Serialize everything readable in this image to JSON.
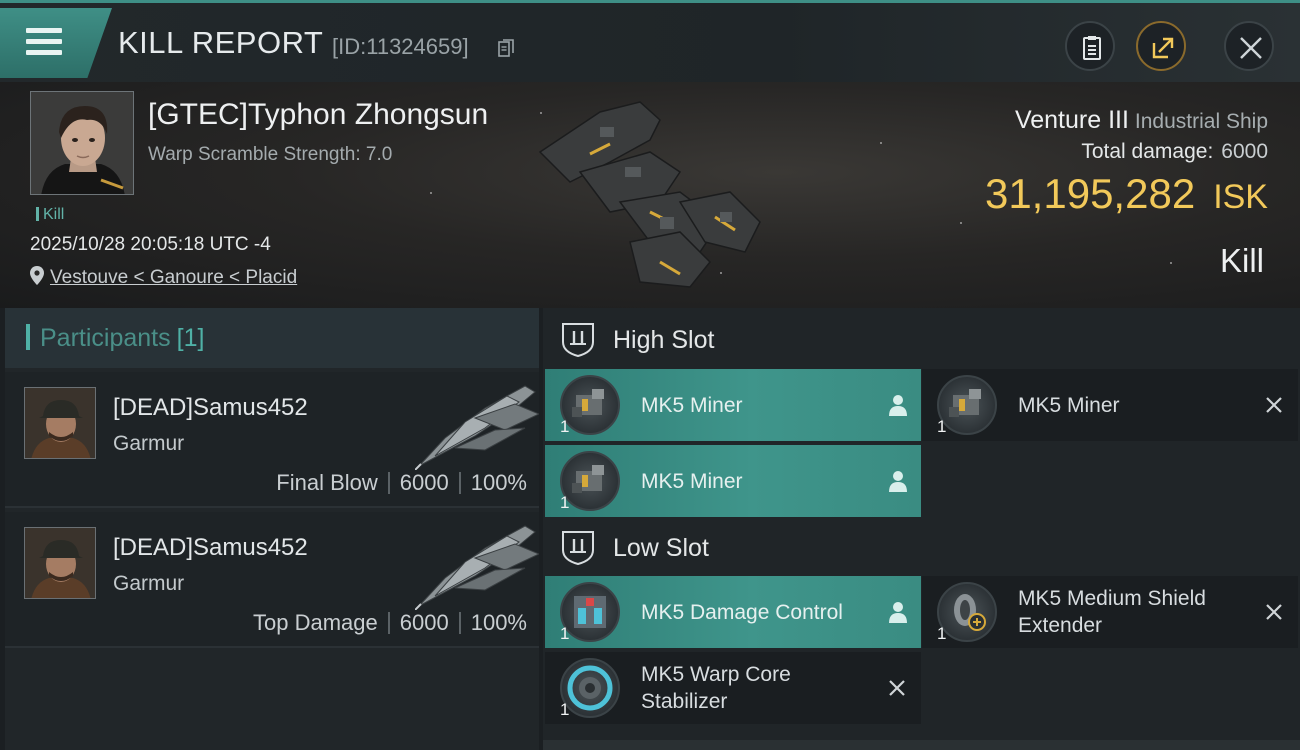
{
  "header": {
    "title": "KILL REPORT",
    "report_id": "[ID:11324659]"
  },
  "victim": {
    "name": "[GTEC]Typhon Zhongsun",
    "warp_scramble": "Warp Scramble Strength: 7.0",
    "tag": "Kill",
    "timestamp": "2025/10/28 20:05:18 UTC -4",
    "location": "Vestouve < Ganoure < Placid",
    "ship_name": "Venture III",
    "ship_class": "Industrial Ship",
    "total_damage_label": "Total damage:",
    "total_damage_value": "6000",
    "isk_value": "31,195,282",
    "isk_unit": "ISK",
    "result": "Kill"
  },
  "participants": {
    "label": "Participants",
    "count": "[1]",
    "items": [
      {
        "name": "[DEAD]Samus452",
        "ship": "Garmur",
        "role": "Final Blow",
        "damage": "6000",
        "percent": "100%"
      },
      {
        "name": "[DEAD]Samus452",
        "ship": "Garmur",
        "role": "Top Damage",
        "damage": "6000",
        "percent": "100%"
      }
    ]
  },
  "fitting": {
    "high_slot_label": "High Slot",
    "low_slot_label": "Low Slot",
    "high": [
      {
        "name": "MK5 Miner",
        "qty": "1",
        "state": "fitted"
      },
      {
        "name": "MK5 Miner",
        "qty": "1",
        "state": "destroyed"
      },
      {
        "name": "MK5 Miner",
        "qty": "1",
        "state": "fitted"
      }
    ],
    "low": [
      {
        "name": "MK5 Damage Control",
        "qty": "1",
        "state": "fitted"
      },
      {
        "name": "MK5 Medium Shield Extender",
        "qty": "1",
        "state": "destroyed"
      },
      {
        "name": "MK5 Warp Core Stabilizer",
        "qty": "1",
        "state": "destroyed"
      }
    ]
  },
  "colors": {
    "accent": "#3f958b",
    "isk": "#f2c95a",
    "header_band": "#3e8f86"
  },
  "icons": [
    "menu-icon",
    "copy-icon",
    "clipboard-icon",
    "share-icon",
    "close-icon",
    "location-pin-icon",
    "slot-shield-icon",
    "pilot-icon",
    "destroyed-x-icon"
  ]
}
